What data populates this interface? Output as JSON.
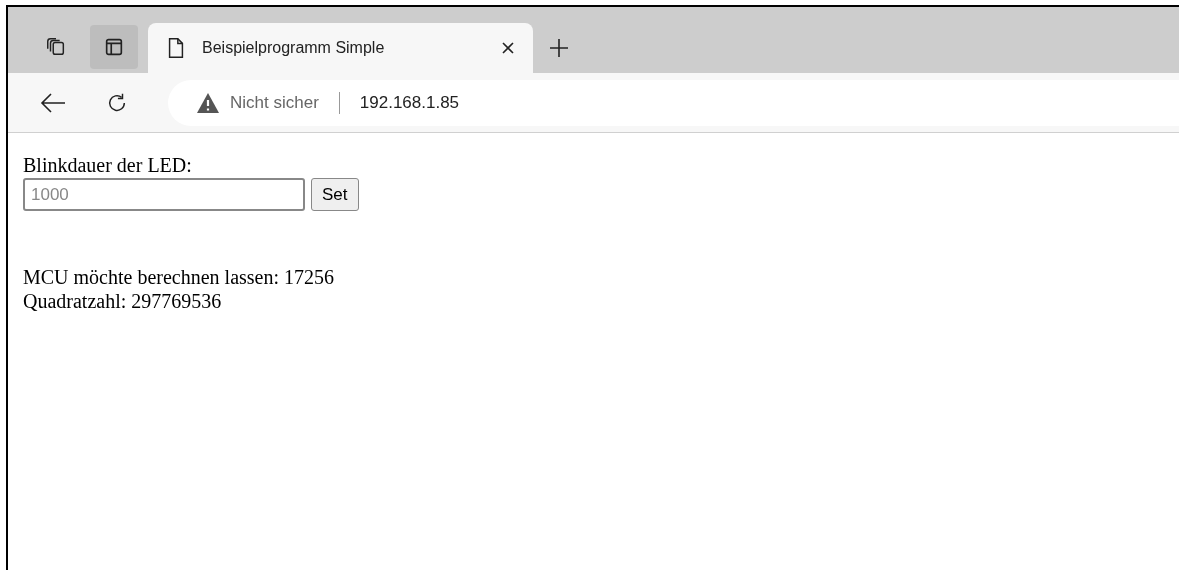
{
  "browser": {
    "tab": {
      "title": "Beispielprogramm Simple",
      "selected": true
    },
    "address": {
      "security": "Nicht sicher",
      "url": "192.168.1.85"
    }
  },
  "page": {
    "label": "Blinkdauer der LED:",
    "input": {
      "placeholder": "1000"
    },
    "button": "Set",
    "lines": [
      "MCU möchte berechnen lassen: 17256",
      "Quadratzahl: 297769536"
    ]
  }
}
